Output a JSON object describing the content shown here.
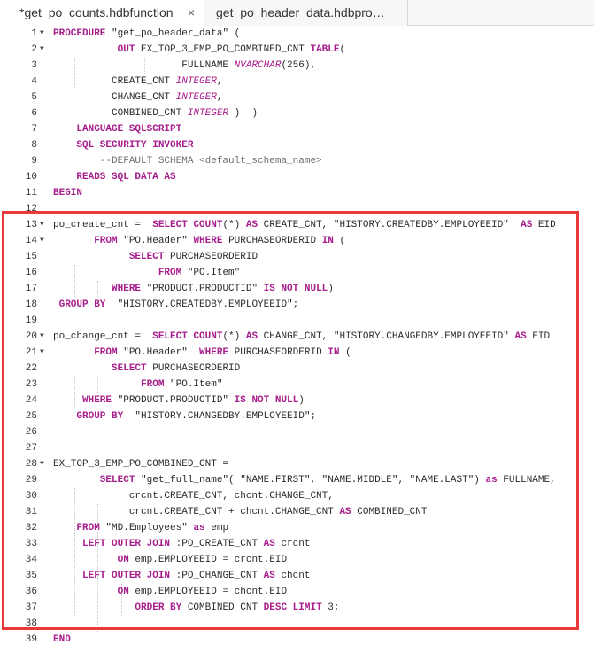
{
  "tabs": [
    {
      "title": "*get_po_counts.hdbfunction",
      "close": "×"
    },
    {
      "title": "get_po_header_data.hdbproce..."
    }
  ],
  "lines": [
    {
      "num": "1",
      "fold": true,
      "tokens": [
        {
          "t": "PROCEDURE",
          "c": "kw"
        },
        {
          "t": " \"get_po_header_data\" (",
          "c": "plain"
        }
      ]
    },
    {
      "num": "2",
      "fold": true,
      "tokens": [
        {
          "t": "           ",
          "c": "plain"
        },
        {
          "t": "OUT",
          "c": "kw"
        },
        {
          "t": " EX_TOP_3_EMP_PO_COMBINED_CNT ",
          "c": "plain"
        },
        {
          "t": "TABLE",
          "c": "kw"
        },
        {
          "t": "(",
          "c": "plain"
        }
      ]
    },
    {
      "num": "3",
      "tokens": [
        {
          "t": "                      FULLNAME ",
          "c": "plain"
        },
        {
          "t": "NVARCHAR",
          "c": "ty"
        },
        {
          "t": "(256),",
          "c": "plain"
        }
      ]
    },
    {
      "num": "4",
      "tokens": [
        {
          "t": "          CREATE_CNT ",
          "c": "plain"
        },
        {
          "t": "INTEGER",
          "c": "ty"
        },
        {
          "t": ",",
          "c": "plain"
        }
      ]
    },
    {
      "num": "5",
      "tokens": [
        {
          "t": "          CHANGE_CNT ",
          "c": "plain"
        },
        {
          "t": "INTEGER",
          "c": "ty"
        },
        {
          "t": ",",
          "c": "plain"
        }
      ]
    },
    {
      "num": "6",
      "tokens": [
        {
          "t": "          COMBINED_CNT ",
          "c": "plain"
        },
        {
          "t": "INTEGER",
          "c": "ty"
        },
        {
          "t": " )  )",
          "c": "plain"
        }
      ]
    },
    {
      "num": "7",
      "tokens": [
        {
          "t": "    LANGUAGE ",
          "c": "kw"
        },
        {
          "t": "SQLSCRIPT",
          "c": "kw"
        }
      ]
    },
    {
      "num": "8",
      "tokens": [
        {
          "t": "    SQL SECURITY INVOKER",
          "c": "kw"
        }
      ]
    },
    {
      "num": "9",
      "tokens": [
        {
          "t": "        --DEFAULT SCHEMA <default_schema_name>",
          "c": "cm"
        }
      ]
    },
    {
      "num": "10",
      "tokens": [
        {
          "t": "    READS SQL DATA AS",
          "c": "kw"
        }
      ]
    },
    {
      "num": "11",
      "tokens": [
        {
          "t": "BEGIN",
          "c": "kw"
        }
      ]
    },
    {
      "num": "12",
      "tokens": []
    },
    {
      "num": "13",
      "fold": true,
      "tokens": [
        {
          "t": "po_create_cnt =  ",
          "c": "plain"
        },
        {
          "t": "SELECT",
          "c": "kw"
        },
        {
          "t": " ",
          "c": "plain"
        },
        {
          "t": "COUNT",
          "c": "kw"
        },
        {
          "t": "(*) ",
          "c": "plain"
        },
        {
          "t": "AS",
          "c": "kw"
        },
        {
          "t": " CREATE_CNT, \"HISTORY.CREATEDBY.EMPLOYEEID\"  ",
          "c": "plain"
        },
        {
          "t": "AS",
          "c": "kw"
        },
        {
          "t": " EID",
          "c": "plain"
        }
      ]
    },
    {
      "num": "14",
      "fold": true,
      "tokens": [
        {
          "t": "       FROM",
          "c": "kw"
        },
        {
          "t": " \"PO.Header\" ",
          "c": "plain"
        },
        {
          "t": "WHERE",
          "c": "kw"
        },
        {
          "t": " PURCHASEORDERID ",
          "c": "plain"
        },
        {
          "t": "IN",
          "c": "kw"
        },
        {
          "t": " (",
          "c": "plain"
        }
      ]
    },
    {
      "num": "15",
      "tokens": [
        {
          "t": "             SELECT",
          "c": "kw"
        },
        {
          "t": " PURCHASEORDERID",
          "c": "plain"
        }
      ]
    },
    {
      "num": "16",
      "tokens": [
        {
          "t": "                  FROM",
          "c": "kw"
        },
        {
          "t": " \"PO.Item\"",
          "c": "plain"
        }
      ]
    },
    {
      "num": "17",
      "tokens": [
        {
          "t": "          WHERE",
          "c": "kw"
        },
        {
          "t": " \"PRODUCT.PRODUCTID\" ",
          "c": "plain"
        },
        {
          "t": "IS NOT NULL",
          "c": "kw"
        },
        {
          "t": ")",
          "c": "plain"
        }
      ]
    },
    {
      "num": "18",
      "tokens": [
        {
          "t": " GROUP BY",
          "c": "kw"
        },
        {
          "t": "  \"HISTORY.CREATEDBY.EMPLOYEEID\";",
          "c": "plain"
        }
      ]
    },
    {
      "num": "19",
      "tokens": []
    },
    {
      "num": "20",
      "fold": true,
      "tokens": [
        {
          "t": "po_change_cnt =  ",
          "c": "plain"
        },
        {
          "t": "SELECT",
          "c": "kw"
        },
        {
          "t": " ",
          "c": "plain"
        },
        {
          "t": "COUNT",
          "c": "kw"
        },
        {
          "t": "(*) ",
          "c": "plain"
        },
        {
          "t": "AS",
          "c": "kw"
        },
        {
          "t": " CHANGE_CNT, \"HISTORY.CHANGEDBY.EMPLOYEEID\" ",
          "c": "plain"
        },
        {
          "t": "AS",
          "c": "kw"
        },
        {
          "t": " EID",
          "c": "plain"
        }
      ]
    },
    {
      "num": "21",
      "fold": true,
      "tokens": [
        {
          "t": "       FROM",
          "c": "kw"
        },
        {
          "t": " \"PO.Header\"  ",
          "c": "plain"
        },
        {
          "t": "WHERE",
          "c": "kw"
        },
        {
          "t": " PURCHASEORDERID ",
          "c": "plain"
        },
        {
          "t": "IN",
          "c": "kw"
        },
        {
          "t": " (",
          "c": "plain"
        }
      ]
    },
    {
      "num": "22",
      "tokens": [
        {
          "t": "          SELECT",
          "c": "kw"
        },
        {
          "t": " PURCHASEORDERID",
          "c": "plain"
        }
      ]
    },
    {
      "num": "23",
      "tokens": [
        {
          "t": "               FROM",
          "c": "kw"
        },
        {
          "t": " \"PO.Item\"",
          "c": "plain"
        }
      ]
    },
    {
      "num": "24",
      "tokens": [
        {
          "t": "     WHERE",
          "c": "kw"
        },
        {
          "t": " \"PRODUCT.PRODUCTID\" ",
          "c": "plain"
        },
        {
          "t": "IS NOT NULL",
          "c": "kw"
        },
        {
          "t": ")",
          "c": "plain"
        }
      ]
    },
    {
      "num": "25",
      "tokens": [
        {
          "t": "    GROUP BY",
          "c": "kw"
        },
        {
          "t": "  \"HISTORY.CHANGEDBY.EMPLOYEEID\";",
          "c": "plain"
        }
      ]
    },
    {
      "num": "26",
      "tokens": []
    },
    {
      "num": "27",
      "tokens": []
    },
    {
      "num": "28",
      "fold": true,
      "tokens": [
        {
          "t": "EX_TOP_3_EMP_PO_COMBINED_CNT =",
          "c": "plain"
        }
      ]
    },
    {
      "num": "29",
      "tokens": [
        {
          "t": "        SELECT",
          "c": "kw"
        },
        {
          "t": " \"get_full_name\"( \"NAME.FIRST\", \"NAME.MIDDLE\", \"NAME.LAST\") ",
          "c": "plain"
        },
        {
          "t": "as",
          "c": "kw"
        },
        {
          "t": " FULLNAME,",
          "c": "plain"
        }
      ]
    },
    {
      "num": "30",
      "tokens": [
        {
          "t": "             crcnt.CREATE_CNT, chcnt.CHANGE_CNT,",
          "c": "plain"
        }
      ]
    },
    {
      "num": "31",
      "tokens": [
        {
          "t": "             crcnt.CREATE_CNT + chcnt.CHANGE_CNT ",
          "c": "plain"
        },
        {
          "t": "AS",
          "c": "kw"
        },
        {
          "t": " COMBINED_CNT",
          "c": "plain"
        }
      ]
    },
    {
      "num": "32",
      "tokens": [
        {
          "t": "    FROM",
          "c": "kw"
        },
        {
          "t": " \"MD.Employees\" ",
          "c": "plain"
        },
        {
          "t": "as",
          "c": "kw"
        },
        {
          "t": " emp",
          "c": "plain"
        }
      ]
    },
    {
      "num": "33",
      "tokens": [
        {
          "t": "     LEFT OUTER JOIN",
          "c": "kw"
        },
        {
          "t": " :PO_CREATE_CNT ",
          "c": "plain"
        },
        {
          "t": "AS",
          "c": "kw"
        },
        {
          "t": " crcnt",
          "c": "plain"
        }
      ]
    },
    {
      "num": "34",
      "tokens": [
        {
          "t": "           ON",
          "c": "kw"
        },
        {
          "t": " emp.EMPLOYEEID = crcnt.EID",
          "c": "plain"
        }
      ]
    },
    {
      "num": "35",
      "tokens": [
        {
          "t": "     LEFT OUTER JOIN",
          "c": "kw"
        },
        {
          "t": " :PO_CHANGE_CNT ",
          "c": "plain"
        },
        {
          "t": "AS",
          "c": "kw"
        },
        {
          "t": " chcnt",
          "c": "plain"
        }
      ]
    },
    {
      "num": "36",
      "tokens": [
        {
          "t": "           ON",
          "c": "kw"
        },
        {
          "t": " emp.EMPLOYEEID = chcnt.EID",
          "c": "plain"
        }
      ]
    },
    {
      "num": "37",
      "tokens": [
        {
          "t": "              ORDER BY",
          "c": "kw"
        },
        {
          "t": " COMBINED_CNT ",
          "c": "plain"
        },
        {
          "t": "DESC LIMIT",
          "c": "kw"
        },
        {
          "t": " 3;",
          "c": "plain"
        }
      ]
    },
    {
      "num": "38",
      "tokens": []
    },
    {
      "num": "39",
      "tokens": [
        {
          "t": "END",
          "c": "kw"
        }
      ]
    }
  ]
}
